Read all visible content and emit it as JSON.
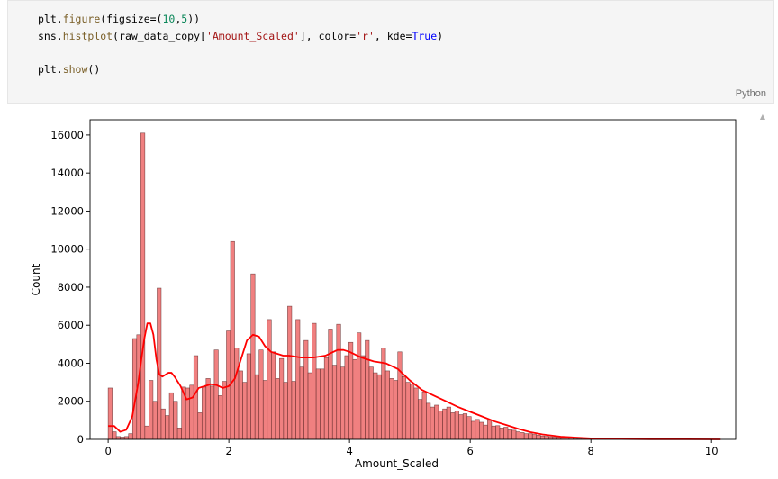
{
  "code_cell": {
    "language": "Python",
    "lines": [
      [
        {
          "t": "plt.",
          "c": ""
        },
        {
          "t": "figure",
          "c": "fn"
        },
        {
          "t": "(figsize=(",
          "c": ""
        },
        {
          "t": "10",
          "c": "num"
        },
        {
          "t": ",",
          "c": ""
        },
        {
          "t": "5",
          "c": "num"
        },
        {
          "t": "))",
          "c": ""
        }
      ],
      [
        {
          "t": "sns.",
          "c": ""
        },
        {
          "t": "histplot",
          "c": "fn"
        },
        {
          "t": "(raw_data_copy[",
          "c": ""
        },
        {
          "t": "'Amount_Scaled'",
          "c": "str"
        },
        {
          "t": "], color=",
          "c": ""
        },
        {
          "t": "'r'",
          "c": "str"
        },
        {
          "t": ", kde=",
          "c": ""
        },
        {
          "t": "True",
          "c": "kw"
        },
        {
          "t": ")",
          "c": ""
        }
      ],
      [],
      [
        {
          "t": "plt.",
          "c": ""
        },
        {
          "t": "show",
          "c": "fn"
        },
        {
          "t": "()",
          "c": ""
        }
      ]
    ]
  },
  "chart_data": {
    "type": "bar",
    "subtype": "histogram_with_kde",
    "title": "",
    "xlabel": "Amount_Scaled",
    "ylabel": "Count",
    "xlim": [
      -0.3,
      10.4
    ],
    "ylim": [
      0,
      16800
    ],
    "xticks": [
      0,
      2,
      4,
      6,
      8,
      10
    ],
    "yticks": [
      0,
      2000,
      4000,
      6000,
      8000,
      10000,
      12000,
      14000,
      16000
    ],
    "bin_width": 0.0676,
    "bin_start": 0.0,
    "bar_color": "#f08080",
    "bar_edge": "#4a1a1a",
    "kde_color": "#ff0000",
    "counts": [
      2700,
      400,
      150,
      120,
      150,
      300,
      5300,
      5500,
      16100,
      700,
      3100,
      2000,
      7950,
      1600,
      1250,
      2450,
      2000,
      600,
      2750,
      2700,
      2850,
      4400,
      1400,
      2750,
      3200,
      2800,
      4700,
      2300,
      3050,
      5700,
      10400,
      4800,
      3600,
      3000,
      4500,
      8700,
      3400,
      4700,
      3100,
      6300,
      4600,
      3200,
      4250,
      3000,
      7000,
      3050,
      6300,
      3800,
      5200,
      3500,
      6100,
      3700,
      3700,
      4300,
      5800,
      3900,
      6050,
      3800,
      4400,
      5100,
      4200,
      5600,
      4400,
      5200,
      3800,
      3500,
      3400,
      4800,
      3600,
      3200,
      3100,
      4600,
      3300,
      3000,
      2900,
      2700,
      2100,
      2500,
      1900,
      1700,
      1800,
      1500,
      1600,
      1700,
      1400,
      1500,
      1300,
      1350,
      1200,
      950,
      1050,
      900,
      750,
      1000,
      700,
      720,
      600,
      640,
      500,
      480,
      400,
      360,
      300,
      300,
      260,
      220,
      180,
      160,
      140,
      120,
      100,
      80,
      70,
      60,
      50,
      40,
      30,
      20,
      15,
      10,
      8,
      5,
      4,
      2,
      2,
      1,
      1,
      1,
      1,
      1,
      1,
      1,
      1,
      1,
      1,
      1,
      1,
      1,
      1,
      1,
      1,
      1,
      1,
      1,
      1,
      1
    ],
    "kde": {
      "x": [
        0.0,
        0.1,
        0.2,
        0.3,
        0.4,
        0.5,
        0.55,
        0.6,
        0.65,
        0.7,
        0.75,
        0.8,
        0.85,
        0.9,
        1.0,
        1.05,
        1.1,
        1.2,
        1.3,
        1.4,
        1.5,
        1.6,
        1.7,
        1.8,
        1.9,
        2.0,
        2.1,
        2.2,
        2.3,
        2.4,
        2.5,
        2.6,
        2.7,
        2.8,
        2.9,
        3.0,
        3.2,
        3.4,
        3.6,
        3.8,
        3.9,
        4.0,
        4.2,
        4.4,
        4.6,
        4.8,
        5.0,
        5.2,
        5.4,
        5.6,
        5.8,
        6.0,
        6.2,
        6.4,
        6.6,
        6.8,
        7.0,
        7.2,
        7.5,
        8.0,
        8.5,
        9.0,
        9.5,
        10.15
      ],
      "y": [
        700,
        700,
        400,
        500,
        1200,
        3000,
        4200,
        5300,
        6100,
        6100,
        5500,
        4200,
        3400,
        3300,
        3500,
        3500,
        3300,
        2800,
        2100,
        2200,
        2700,
        2800,
        2900,
        2850,
        2700,
        2800,
        3200,
        4200,
        5200,
        5500,
        5400,
        4900,
        4600,
        4500,
        4400,
        4400,
        4300,
        4300,
        4400,
        4700,
        4700,
        4600,
        4300,
        4100,
        4000,
        3700,
        3100,
        2600,
        2300,
        2000,
        1700,
        1450,
        1200,
        950,
        750,
        550,
        380,
        260,
        140,
        50,
        20,
        10,
        5,
        0
      ]
    }
  }
}
